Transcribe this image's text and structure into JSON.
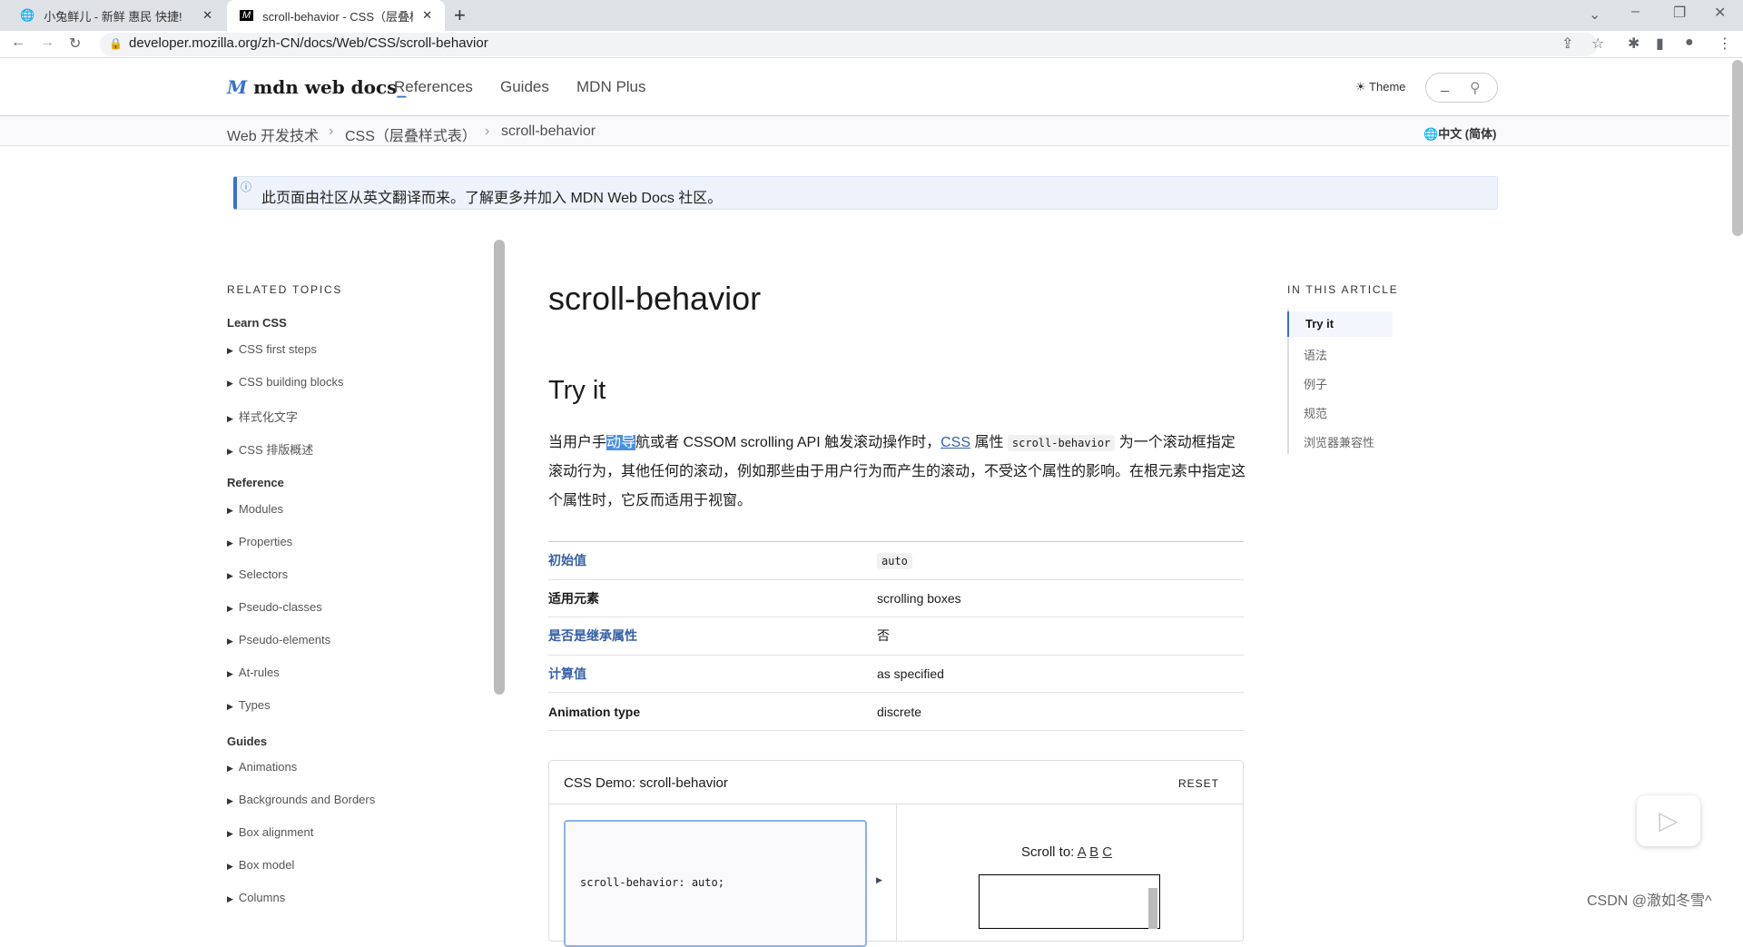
{
  "browser": {
    "tabs": [
      {
        "title": "小兔鲜儿 - 新鲜 惠民 快捷!",
        "active": false
      },
      {
        "title": "scroll-behavior - CSS（层叠样式表）",
        "active": true
      }
    ],
    "new_tab": "+",
    "url": "developer.mozilla.org/zh-CN/docs/Web/CSS/scroll-behavior"
  },
  "header": {
    "logo": "mdn web docs",
    "nav": [
      "References",
      "Guides",
      "MDN Plus"
    ],
    "theme": "Theme",
    "search_placeholder": "_"
  },
  "breadcrumb": [
    "Web 开发技术",
    "CSS（层叠样式表）",
    "scroll-behavior"
  ],
  "language": "中文 (简体)",
  "notice": "此页面由社区从英文翻译而来。了解更多并加入 MDN Web Docs 社区。",
  "sidebar": {
    "title": "RELATED TOPICS",
    "groups": [
      {
        "label": "Learn CSS",
        "items": [
          "CSS first steps",
          "CSS building blocks",
          "样式化文字",
          "CSS 排版概述"
        ]
      },
      {
        "label": "Reference",
        "items": [
          "Modules",
          "Properties",
          "Selectors",
          "Pseudo-classes",
          "Pseudo-elements",
          "At-rules",
          "Types"
        ]
      },
      {
        "label": "Guides",
        "items": [
          "Animations",
          "Backgrounds and Borders",
          "Box alignment",
          "Box model",
          "Columns"
        ]
      }
    ]
  },
  "main": {
    "title": "scroll-behavior",
    "section": "Try it",
    "para": {
      "p1": "当用户手",
      "sel": "动导",
      "p2": "航或者 CSSOM scrolling API 触发滚动操作时，",
      "link": "CSS",
      "p3": " 属性 ",
      "code": "scroll-behavior",
      "p4": " 为一个滚动框指定滚动行为，其他任何的滚动，例如那些由于用户行为而产生的滚动，不受这个属性的影响。在根元素中指定这个属性时，它反而适用于视窗。"
    },
    "table": [
      {
        "k": "初始值",
        "v": "auto",
        "link": true,
        "code": true
      },
      {
        "k": "适用元素",
        "v": "scrolling boxes"
      },
      {
        "k": "是否是继承属性",
        "v": "否",
        "link": true
      },
      {
        "k": "计算值",
        "v": "as specified",
        "link": true
      },
      {
        "k": "Animation type",
        "v": "discrete"
      }
    ],
    "demo": {
      "title": "CSS Demo: scroll-behavior",
      "reset": "RESET",
      "code": "scroll-behavior: auto;",
      "scroll_to": "Scroll to:",
      "targets": [
        "A",
        "B",
        "C"
      ]
    }
  },
  "toc": {
    "title": "IN THIS ARTICLE",
    "items": [
      "Try it",
      "语法",
      "例子",
      "规范",
      "浏览器兼容性"
    ],
    "active": 0
  },
  "watermark": "CSDN @澈如冬雪^",
  "colors": {
    "accent": "#3760a8",
    "selection": "#4a90e2"
  }
}
